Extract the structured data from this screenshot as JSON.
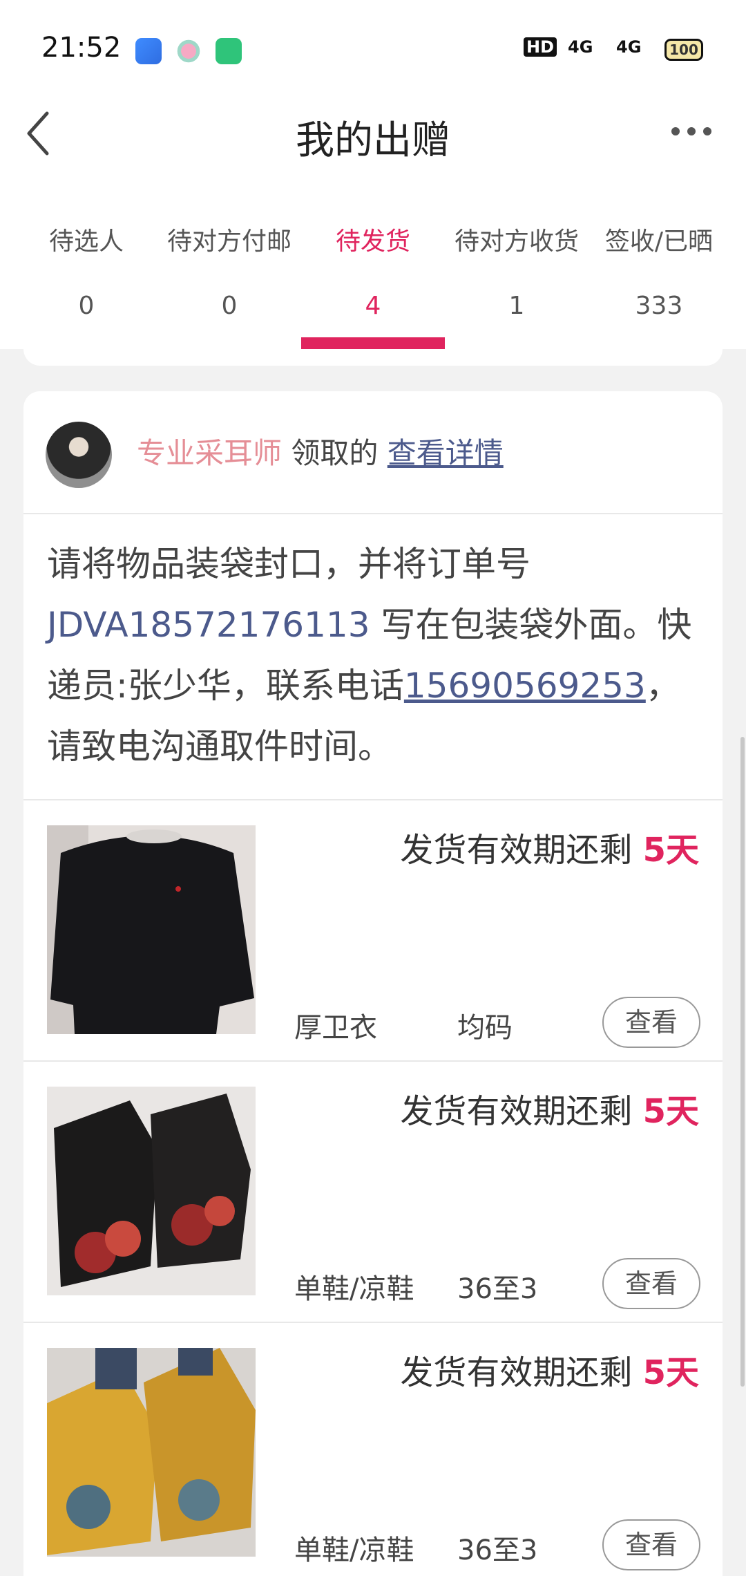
{
  "status_bar": {
    "time": "21:52",
    "hd_label": "HD",
    "signal1": "4G",
    "signal2": "4G",
    "battery": "100",
    "app_icons": [
      "blue-app-icon",
      "pink-app-icon",
      "green-app-icon"
    ]
  },
  "nav": {
    "title": "我的出赠"
  },
  "tabs": [
    {
      "label": "待选人",
      "count": "0"
    },
    {
      "label": "待对方付邮",
      "count": "0"
    },
    {
      "label": "待发货",
      "count": "4"
    },
    {
      "label": "待对方收货",
      "count": "1"
    },
    {
      "label": "签收/已晒",
      "count": "333"
    }
  ],
  "colors": {
    "accent": "#e0245e",
    "link": "#4c5a8c",
    "username": "#e58e96"
  },
  "order": {
    "username": "专业采耳师",
    "received_text": "领取的",
    "details_link": "查看详情",
    "instruction": {
      "part1": "请将物品装袋封口，并将订单号 ",
      "order_no": "JDVA18572176113",
      "part2": " 写在包装袋外面。快递员:张少华，联系电话",
      "phone": "15690569253",
      "part3": "，请致电沟通取件时间。"
    }
  },
  "items": [
    {
      "deadline_prefix": "发货有效期还剩 ",
      "days": "5天",
      "name": "厚卫衣",
      "size": "均码",
      "view_label": "查看"
    },
    {
      "deadline_prefix": "发货有效期还剩 ",
      "days": "5天",
      "name": "单鞋/凉鞋",
      "size": "36至3",
      "view_label": "查看"
    },
    {
      "deadline_prefix": "发货有效期还剩 ",
      "days": "5天",
      "name": "单鞋/凉鞋",
      "size": "36至3",
      "view_label": "查看"
    }
  ]
}
